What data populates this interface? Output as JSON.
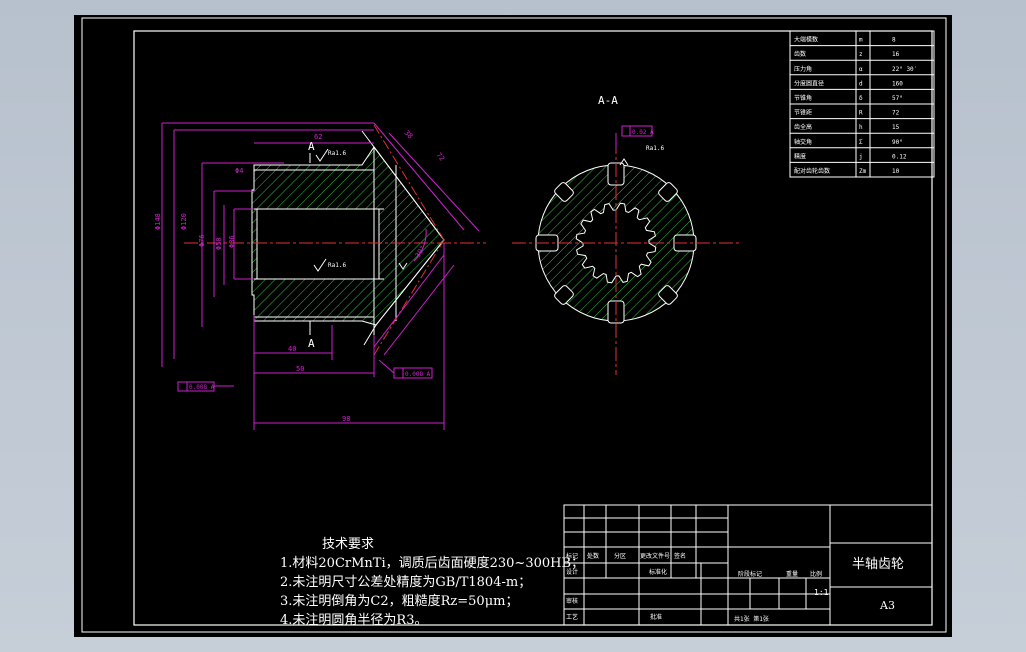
{
  "section_title": "A-A",
  "section_marks": [
    "A",
    "A"
  ],
  "params": [
    {
      "name": "大端模数",
      "sym": "m",
      "val": "8"
    },
    {
      "name": "齿数",
      "sym": "z",
      "val": "16"
    },
    {
      "name": "压力角",
      "sym": "α",
      "val": "22° 30′"
    },
    {
      "name": "分度圆直径",
      "sym": "d",
      "val": "160"
    },
    {
      "name": "节锥角",
      "sym": "δ",
      "val": "57°"
    },
    {
      "name": "节锥距",
      "sym": "R",
      "val": "72"
    },
    {
      "name": "齿全高",
      "sym": "h",
      "val": "15"
    },
    {
      "name": "轴交角",
      "sym": "Σ",
      "val": "90°"
    },
    {
      "name": "精度",
      "sym": "j",
      "val": "0.12"
    },
    {
      "name": "配对齿轮齿数",
      "sym": "Zm",
      "val": "10"
    }
  ],
  "dims": {
    "d1": "62",
    "d2": "38",
    "d3": "Φ4",
    "d4": "Φ148",
    "d5": "Φ120",
    "d6": "Φ76",
    "d7": "Φ50",
    "d8": "Φ36",
    "d9": "Φ38",
    "d10": "40",
    "d11": "50",
    "d12": "98",
    "d13": "30°",
    "d14": "R5",
    "d15": "72"
  },
  "roughness": [
    "Ra1.6",
    "Ra1.6",
    "Ra1.6"
  ],
  "tolerances": [
    "0.02 A",
    "0.008 A",
    "0.008 A"
  ],
  "tech_req": {
    "title": "技术要求",
    "items": [
      "1.材料20CrMnTi，调质后齿面硬度230~300HB；",
      "2.未注明尺寸公差处精度为GB/T1804-m；",
      "3.未注明倒角为C2，粗糙度Rz=50μm；",
      "4.未注明圆角半径为R3。"
    ]
  },
  "title_block": {
    "row_labels": [
      "标记",
      "处数",
      "分区",
      "更改文件号",
      "签名"
    ],
    "design": "设计",
    "standard": "标准化",
    "review": "审核",
    "craft": "工艺",
    "approve": "批准",
    "stage": "阶段标记",
    "weight": "重量",
    "scale_label": "比例",
    "scale": "1:1",
    "sheets": "共1张 第1张",
    "part_name": "半轴齿轮",
    "size": "A3"
  }
}
